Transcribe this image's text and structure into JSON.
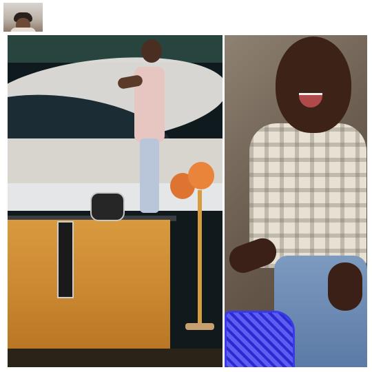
{
  "header": {
    "avatar_icon": "user-avatar-icon"
  },
  "panels": {
    "left": {
      "name": "stage-scene"
    },
    "right": {
      "name": "crying-boy-scene"
    }
  },
  "colors": {
    "background": "#ffffff",
    "table": "#d99a3e",
    "balloon": "#e9843a",
    "basket": "#3b3be6"
  }
}
